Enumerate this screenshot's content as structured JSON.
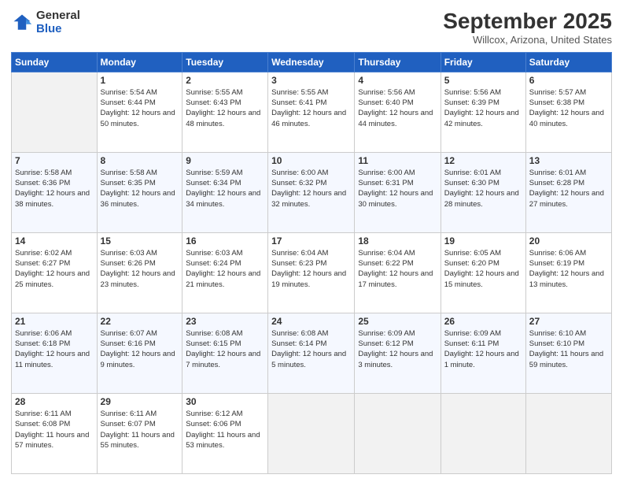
{
  "header": {
    "logo_line1": "General",
    "logo_line2": "Blue",
    "month": "September 2025",
    "location": "Willcox, Arizona, United States"
  },
  "days_of_week": [
    "Sunday",
    "Monday",
    "Tuesday",
    "Wednesday",
    "Thursday",
    "Friday",
    "Saturday"
  ],
  "weeks": [
    [
      {
        "day": "",
        "empty": true
      },
      {
        "day": "1",
        "sunrise": "Sunrise: 5:54 AM",
        "sunset": "Sunset: 6:44 PM",
        "daylight": "Daylight: 12 hours and 50 minutes."
      },
      {
        "day": "2",
        "sunrise": "Sunrise: 5:55 AM",
        "sunset": "Sunset: 6:43 PM",
        "daylight": "Daylight: 12 hours and 48 minutes."
      },
      {
        "day": "3",
        "sunrise": "Sunrise: 5:55 AM",
        "sunset": "Sunset: 6:41 PM",
        "daylight": "Daylight: 12 hours and 46 minutes."
      },
      {
        "day": "4",
        "sunrise": "Sunrise: 5:56 AM",
        "sunset": "Sunset: 6:40 PM",
        "daylight": "Daylight: 12 hours and 44 minutes."
      },
      {
        "day": "5",
        "sunrise": "Sunrise: 5:56 AM",
        "sunset": "Sunset: 6:39 PM",
        "daylight": "Daylight: 12 hours and 42 minutes."
      },
      {
        "day": "6",
        "sunrise": "Sunrise: 5:57 AM",
        "sunset": "Sunset: 6:38 PM",
        "daylight": "Daylight: 12 hours and 40 minutes."
      }
    ],
    [
      {
        "day": "7",
        "sunrise": "Sunrise: 5:58 AM",
        "sunset": "Sunset: 6:36 PM",
        "daylight": "Daylight: 12 hours and 38 minutes."
      },
      {
        "day": "8",
        "sunrise": "Sunrise: 5:58 AM",
        "sunset": "Sunset: 6:35 PM",
        "daylight": "Daylight: 12 hours and 36 minutes."
      },
      {
        "day": "9",
        "sunrise": "Sunrise: 5:59 AM",
        "sunset": "Sunset: 6:34 PM",
        "daylight": "Daylight: 12 hours and 34 minutes."
      },
      {
        "day": "10",
        "sunrise": "Sunrise: 6:00 AM",
        "sunset": "Sunset: 6:32 PM",
        "daylight": "Daylight: 12 hours and 32 minutes."
      },
      {
        "day": "11",
        "sunrise": "Sunrise: 6:00 AM",
        "sunset": "Sunset: 6:31 PM",
        "daylight": "Daylight: 12 hours and 30 minutes."
      },
      {
        "day": "12",
        "sunrise": "Sunrise: 6:01 AM",
        "sunset": "Sunset: 6:30 PM",
        "daylight": "Daylight: 12 hours and 28 minutes."
      },
      {
        "day": "13",
        "sunrise": "Sunrise: 6:01 AM",
        "sunset": "Sunset: 6:28 PM",
        "daylight": "Daylight: 12 hours and 27 minutes."
      }
    ],
    [
      {
        "day": "14",
        "sunrise": "Sunrise: 6:02 AM",
        "sunset": "Sunset: 6:27 PM",
        "daylight": "Daylight: 12 hours and 25 minutes."
      },
      {
        "day": "15",
        "sunrise": "Sunrise: 6:03 AM",
        "sunset": "Sunset: 6:26 PM",
        "daylight": "Daylight: 12 hours and 23 minutes."
      },
      {
        "day": "16",
        "sunrise": "Sunrise: 6:03 AM",
        "sunset": "Sunset: 6:24 PM",
        "daylight": "Daylight: 12 hours and 21 minutes."
      },
      {
        "day": "17",
        "sunrise": "Sunrise: 6:04 AM",
        "sunset": "Sunset: 6:23 PM",
        "daylight": "Daylight: 12 hours and 19 minutes."
      },
      {
        "day": "18",
        "sunrise": "Sunrise: 6:04 AM",
        "sunset": "Sunset: 6:22 PM",
        "daylight": "Daylight: 12 hours and 17 minutes."
      },
      {
        "day": "19",
        "sunrise": "Sunrise: 6:05 AM",
        "sunset": "Sunset: 6:20 PM",
        "daylight": "Daylight: 12 hours and 15 minutes."
      },
      {
        "day": "20",
        "sunrise": "Sunrise: 6:06 AM",
        "sunset": "Sunset: 6:19 PM",
        "daylight": "Daylight: 12 hours and 13 minutes."
      }
    ],
    [
      {
        "day": "21",
        "sunrise": "Sunrise: 6:06 AM",
        "sunset": "Sunset: 6:18 PM",
        "daylight": "Daylight: 12 hours and 11 minutes."
      },
      {
        "day": "22",
        "sunrise": "Sunrise: 6:07 AM",
        "sunset": "Sunset: 6:16 PM",
        "daylight": "Daylight: 12 hours and 9 minutes."
      },
      {
        "day": "23",
        "sunrise": "Sunrise: 6:08 AM",
        "sunset": "Sunset: 6:15 PM",
        "daylight": "Daylight: 12 hours and 7 minutes."
      },
      {
        "day": "24",
        "sunrise": "Sunrise: 6:08 AM",
        "sunset": "Sunset: 6:14 PM",
        "daylight": "Daylight: 12 hours and 5 minutes."
      },
      {
        "day": "25",
        "sunrise": "Sunrise: 6:09 AM",
        "sunset": "Sunset: 6:12 PM",
        "daylight": "Daylight: 12 hours and 3 minutes."
      },
      {
        "day": "26",
        "sunrise": "Sunrise: 6:09 AM",
        "sunset": "Sunset: 6:11 PM",
        "daylight": "Daylight: 12 hours and 1 minute."
      },
      {
        "day": "27",
        "sunrise": "Sunrise: 6:10 AM",
        "sunset": "Sunset: 6:10 PM",
        "daylight": "Daylight: 11 hours and 59 minutes."
      }
    ],
    [
      {
        "day": "28",
        "sunrise": "Sunrise: 6:11 AM",
        "sunset": "Sunset: 6:08 PM",
        "daylight": "Daylight: 11 hours and 57 minutes."
      },
      {
        "day": "29",
        "sunrise": "Sunrise: 6:11 AM",
        "sunset": "Sunset: 6:07 PM",
        "daylight": "Daylight: 11 hours and 55 minutes."
      },
      {
        "day": "30",
        "sunrise": "Sunrise: 6:12 AM",
        "sunset": "Sunset: 6:06 PM",
        "daylight": "Daylight: 11 hours and 53 minutes."
      },
      {
        "day": "",
        "empty": true
      },
      {
        "day": "",
        "empty": true
      },
      {
        "day": "",
        "empty": true
      },
      {
        "day": "",
        "empty": true
      }
    ]
  ]
}
